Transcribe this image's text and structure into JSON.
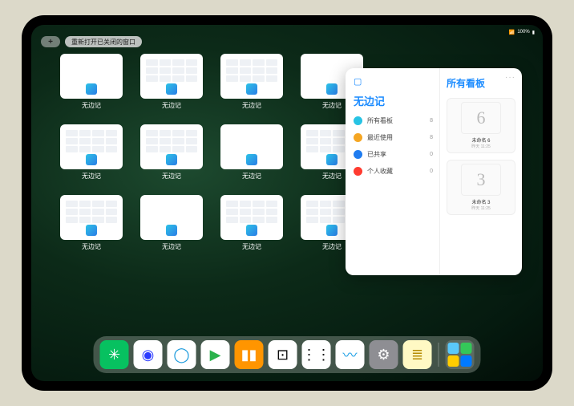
{
  "status": {
    "wifi": "📶",
    "battery_text": "100%"
  },
  "topbar": {
    "plus_label": "+",
    "reopen_label": "重新打开已关闭的窗口"
  },
  "thumbnails": {
    "label": "无边记",
    "items": [
      {
        "kind": "blank"
      },
      {
        "kind": "board"
      },
      {
        "kind": "board"
      },
      {
        "kind": "blank"
      },
      {
        "kind": "board"
      },
      {
        "kind": "board"
      },
      {
        "kind": "blank"
      },
      {
        "kind": "board"
      },
      {
        "kind": "board"
      },
      {
        "kind": "blank"
      },
      {
        "kind": "board"
      },
      {
        "kind": "board"
      }
    ]
  },
  "panel": {
    "app_title": "无边记",
    "more": "···",
    "sections": [
      {
        "icon": "#27c3e4",
        "label": "所有看板",
        "count": "8"
      },
      {
        "icon": "#f5a623",
        "label": "最近使用",
        "count": "8"
      },
      {
        "icon": "#1f7cf0",
        "label": "已共享",
        "count": "0"
      },
      {
        "icon": "#ff3b30",
        "label": "个人收藏",
        "count": "0"
      }
    ],
    "right_title": "所有看板",
    "boards": [
      {
        "glyph": "6",
        "name": "未命名 6",
        "time": "昨天 11:25"
      },
      {
        "glyph": "3",
        "name": "未命名 3",
        "time": "昨天 11:25"
      }
    ]
  },
  "dock": {
    "apps": [
      {
        "name": "wechat",
        "bg": "#07c160",
        "glyph": "✳"
      },
      {
        "name": "quark",
        "bg": "#ffffff",
        "glyph": "◉",
        "fg": "#2b3bff"
      },
      {
        "name": "qqbrowser",
        "bg": "#ffffff",
        "glyph": "◯",
        "fg": "#1296db"
      },
      {
        "name": "play",
        "bg": "#ffffff",
        "glyph": "▶",
        "fg": "#2bb24c"
      },
      {
        "name": "books",
        "bg": "#ff9500",
        "glyph": "▮▮"
      },
      {
        "name": "dice",
        "bg": "#ffffff",
        "glyph": "⊡",
        "fg": "#000"
      },
      {
        "name": "nodes",
        "bg": "#ffffff",
        "glyph": "⋮⋮",
        "fg": "#000"
      },
      {
        "name": "freeform",
        "bg": "#ffffff",
        "glyph": "〰",
        "fg": "#20a0e6"
      },
      {
        "name": "settings",
        "bg": "#8e8e93",
        "glyph": "⚙"
      },
      {
        "name": "notes",
        "bg": "#fff9c4",
        "glyph": "≣",
        "fg": "#b48a00"
      }
    ],
    "stack_colors": [
      "#5ac8fa",
      "#34c759",
      "#ffcc00",
      "#007aff"
    ]
  }
}
